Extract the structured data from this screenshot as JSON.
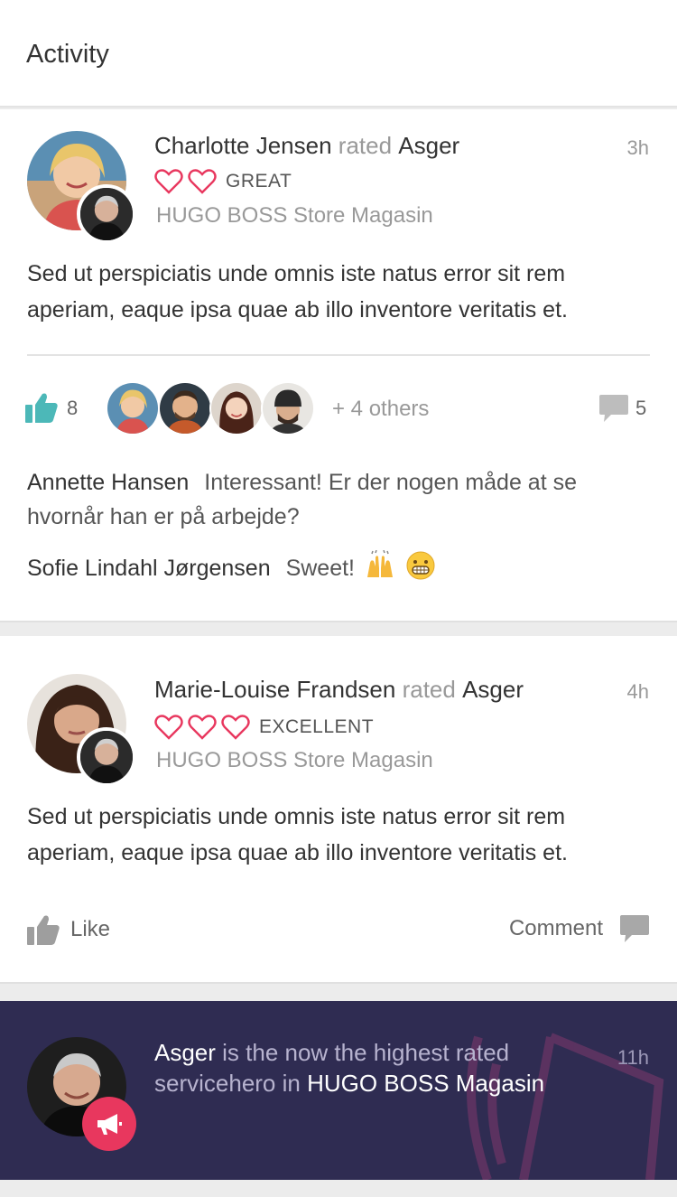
{
  "header": {
    "title": "Activity"
  },
  "cards": [
    {
      "actor": "Charlotte Jensen",
      "verb": "rated",
      "target": "Asger",
      "time": "3h",
      "rating_label": "GREAT",
      "hearts": 2,
      "store": "HUGO BOSS Store Magasin",
      "text": "Sed ut perspiciatis unde omnis iste natus error sit rem aperiam, eaque ipsa quae ab illo inventore veritatis et.",
      "likes": "8",
      "others": "+ 4 others",
      "comments_count": "5",
      "comments": [
        {
          "name": "Annette Hansen",
          "text": "Interessant! Er der nogen måde at se hvornår han er på arbejde?"
        },
        {
          "name": "Sofie Lindahl Jørgensen",
          "text": "Sweet!"
        }
      ]
    },
    {
      "actor": "Marie-Louise Frandsen",
      "verb": "rated",
      "target": "Asger",
      "time": "4h",
      "rating_label": "EXCELLENT",
      "hearts": 3,
      "store": "HUGO BOSS Store Magasin",
      "text": "Sed ut perspiciatis unde omnis iste natus error sit rem aperiam, eaque ipsa quae ab illo inventore veritatis et.",
      "like_label": "Like",
      "comment_label": "Comment"
    }
  ],
  "announcement": {
    "name": "Asger",
    "text_mid": " is the now the highest rated servicehero in ",
    "place": "HUGO BOSS Magasin",
    "time": "11h"
  },
  "colors": {
    "accent_teal": "#4cb8b8",
    "heart_red": "#e8375e",
    "banner_bg": "#2f2c52"
  }
}
